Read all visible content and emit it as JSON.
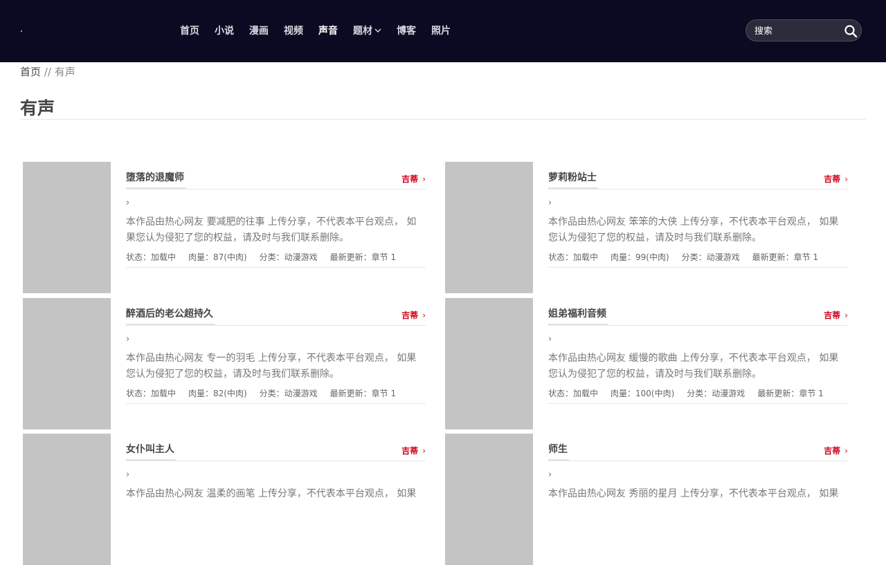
{
  "nav": {
    "items": [
      {
        "label": "首页"
      },
      {
        "label": "小说"
      },
      {
        "label": "漫画"
      },
      {
        "label": "视频"
      },
      {
        "label": "声音"
      },
      {
        "label": "题材"
      },
      {
        "label": "博客"
      },
      {
        "label": "照片"
      }
    ],
    "active": "声音",
    "dropdown_item": "题材"
  },
  "search": {
    "placeholder": "搜索"
  },
  "breadcrumb": {
    "home": "首页",
    "separator": "//",
    "current": "有声"
  },
  "page": {
    "title": "有声"
  },
  "colors": {
    "header_bg": "#0b0a22",
    "author": "#d0021b",
    "thumbnail": "#c4c4c4"
  },
  "cards": [
    {
      "title": "堕落的退魔师",
      "author": "吉蒂",
      "desc": "本作品由热心网友 要减肥的往事 上传分享，不代表本平台观点， 如果您认为侵犯了您的权益，请及时与我们联系删除。",
      "status": "状态：加载中",
      "meat": "肉量：87(中肉)",
      "category": "分类：动漫游戏",
      "update": "最新更新：章节 1"
    },
    {
      "title": "萝莉粉站士",
      "author": "吉蒂",
      "desc": "本作品由热心网友 笨笨的大侠 上传分享，不代表本平台观点， 如果您认为侵犯了您的权益，请及时与我们联系删除。",
      "status": "状态：加载中",
      "meat": "肉量：99(中肉)",
      "category": "分类：动漫游戏",
      "update": "最新更新：章节 1"
    },
    {
      "title": "醉酒后的老公超持久",
      "author": "吉蒂",
      "desc": "本作品由热心网友 专一的羽毛 上传分享，不代表本平台观点， 如果您认为侵犯了您的权益，请及时与我们联系删除。",
      "status": "状态：加载中",
      "meat": "肉量：82(中肉)",
      "category": "分类：动漫游戏",
      "update": "最新更新：章节 1"
    },
    {
      "title": "姐弟福利音频",
      "author": "吉蒂",
      "desc": "本作品由热心网友 缓慢的歌曲 上传分享，不代表本平台观点， 如果您认为侵犯了您的权益，请及时与我们联系删除。",
      "status": "状态：加载中",
      "meat": "肉量：100(中肉)",
      "category": "分类：动漫游戏",
      "update": "最新更新：章节 1"
    },
    {
      "title": "女仆叫主人",
      "author": "吉蒂",
      "desc": "本作品由热心网友 温柔的画笔 上传分享，不代表本平台观点， 如果",
      "status": "",
      "meat": "",
      "category": "",
      "update": ""
    },
    {
      "title": "师生",
      "author": "吉蒂",
      "desc": "本作品由热心网友 秀丽的星月 上传分享，不代表本平台观点， 如果",
      "status": "",
      "meat": "",
      "category": "",
      "update": ""
    }
  ]
}
